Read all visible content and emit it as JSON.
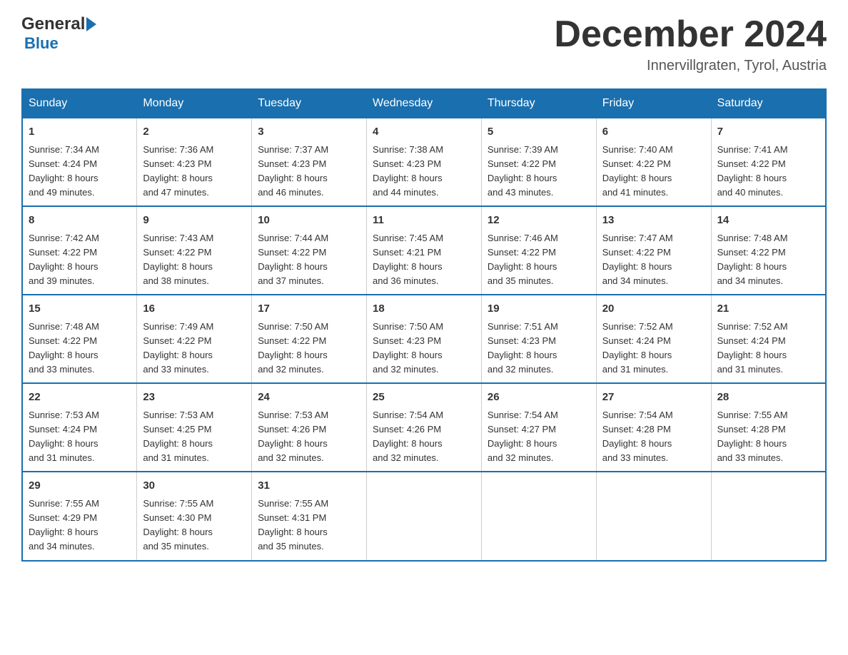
{
  "logo": {
    "text1": "General",
    "text2": "Blue"
  },
  "header": {
    "title": "December 2024",
    "location": "Innervillgraten, Tyrol, Austria"
  },
  "days_of_week": [
    "Sunday",
    "Monday",
    "Tuesday",
    "Wednesday",
    "Thursday",
    "Friday",
    "Saturday"
  ],
  "weeks": [
    [
      {
        "day": "1",
        "sunrise": "7:34 AM",
        "sunset": "4:24 PM",
        "daylight": "8 hours and 49 minutes."
      },
      {
        "day": "2",
        "sunrise": "7:36 AM",
        "sunset": "4:23 PM",
        "daylight": "8 hours and 47 minutes."
      },
      {
        "day": "3",
        "sunrise": "7:37 AM",
        "sunset": "4:23 PM",
        "daylight": "8 hours and 46 minutes."
      },
      {
        "day": "4",
        "sunrise": "7:38 AM",
        "sunset": "4:23 PM",
        "daylight": "8 hours and 44 minutes."
      },
      {
        "day": "5",
        "sunrise": "7:39 AM",
        "sunset": "4:22 PM",
        "daylight": "8 hours and 43 minutes."
      },
      {
        "day": "6",
        "sunrise": "7:40 AM",
        "sunset": "4:22 PM",
        "daylight": "8 hours and 41 minutes."
      },
      {
        "day": "7",
        "sunrise": "7:41 AM",
        "sunset": "4:22 PM",
        "daylight": "8 hours and 40 minutes."
      }
    ],
    [
      {
        "day": "8",
        "sunrise": "7:42 AM",
        "sunset": "4:22 PM",
        "daylight": "8 hours and 39 minutes."
      },
      {
        "day": "9",
        "sunrise": "7:43 AM",
        "sunset": "4:22 PM",
        "daylight": "8 hours and 38 minutes."
      },
      {
        "day": "10",
        "sunrise": "7:44 AM",
        "sunset": "4:22 PM",
        "daylight": "8 hours and 37 minutes."
      },
      {
        "day": "11",
        "sunrise": "7:45 AM",
        "sunset": "4:21 PM",
        "daylight": "8 hours and 36 minutes."
      },
      {
        "day": "12",
        "sunrise": "7:46 AM",
        "sunset": "4:22 PM",
        "daylight": "8 hours and 35 minutes."
      },
      {
        "day": "13",
        "sunrise": "7:47 AM",
        "sunset": "4:22 PM",
        "daylight": "8 hours and 34 minutes."
      },
      {
        "day": "14",
        "sunrise": "7:48 AM",
        "sunset": "4:22 PM",
        "daylight": "8 hours and 34 minutes."
      }
    ],
    [
      {
        "day": "15",
        "sunrise": "7:48 AM",
        "sunset": "4:22 PM",
        "daylight": "8 hours and 33 minutes."
      },
      {
        "day": "16",
        "sunrise": "7:49 AM",
        "sunset": "4:22 PM",
        "daylight": "8 hours and 33 minutes."
      },
      {
        "day": "17",
        "sunrise": "7:50 AM",
        "sunset": "4:22 PM",
        "daylight": "8 hours and 32 minutes."
      },
      {
        "day": "18",
        "sunrise": "7:50 AM",
        "sunset": "4:23 PM",
        "daylight": "8 hours and 32 minutes."
      },
      {
        "day": "19",
        "sunrise": "7:51 AM",
        "sunset": "4:23 PM",
        "daylight": "8 hours and 32 minutes."
      },
      {
        "day": "20",
        "sunrise": "7:52 AM",
        "sunset": "4:24 PM",
        "daylight": "8 hours and 31 minutes."
      },
      {
        "day": "21",
        "sunrise": "7:52 AM",
        "sunset": "4:24 PM",
        "daylight": "8 hours and 31 minutes."
      }
    ],
    [
      {
        "day": "22",
        "sunrise": "7:53 AM",
        "sunset": "4:24 PM",
        "daylight": "8 hours and 31 minutes."
      },
      {
        "day": "23",
        "sunrise": "7:53 AM",
        "sunset": "4:25 PM",
        "daylight": "8 hours and 31 minutes."
      },
      {
        "day": "24",
        "sunrise": "7:53 AM",
        "sunset": "4:26 PM",
        "daylight": "8 hours and 32 minutes."
      },
      {
        "day": "25",
        "sunrise": "7:54 AM",
        "sunset": "4:26 PM",
        "daylight": "8 hours and 32 minutes."
      },
      {
        "day": "26",
        "sunrise": "7:54 AM",
        "sunset": "4:27 PM",
        "daylight": "8 hours and 32 minutes."
      },
      {
        "day": "27",
        "sunrise": "7:54 AM",
        "sunset": "4:28 PM",
        "daylight": "8 hours and 33 minutes."
      },
      {
        "day": "28",
        "sunrise": "7:55 AM",
        "sunset": "4:28 PM",
        "daylight": "8 hours and 33 minutes."
      }
    ],
    [
      {
        "day": "29",
        "sunrise": "7:55 AM",
        "sunset": "4:29 PM",
        "daylight": "8 hours and 34 minutes."
      },
      {
        "day": "30",
        "sunrise": "7:55 AM",
        "sunset": "4:30 PM",
        "daylight": "8 hours and 35 minutes."
      },
      {
        "day": "31",
        "sunrise": "7:55 AM",
        "sunset": "4:31 PM",
        "daylight": "8 hours and 35 minutes."
      },
      null,
      null,
      null,
      null
    ]
  ],
  "labels": {
    "sunrise": "Sunrise:",
    "sunset": "Sunset:",
    "daylight": "Daylight:"
  }
}
